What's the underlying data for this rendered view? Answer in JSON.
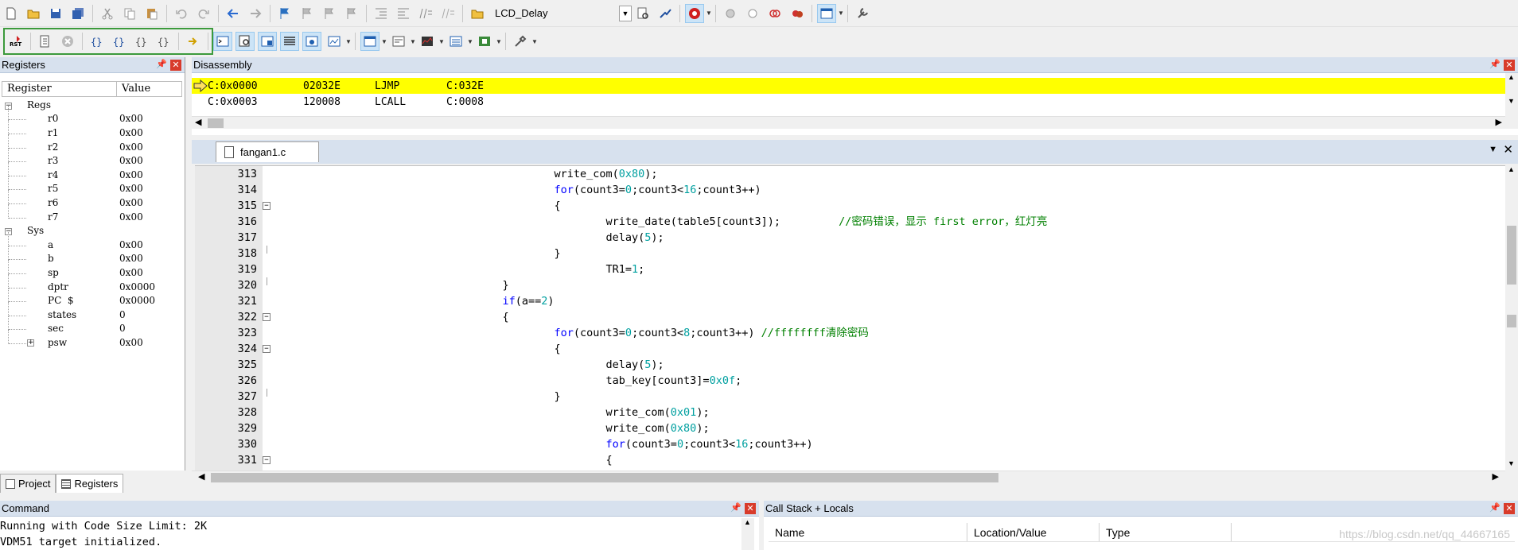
{
  "toolbar": {
    "target_combo": "LCD_Delay"
  },
  "registers": {
    "title": "Registers",
    "col_register": "Register",
    "col_value": "Value",
    "groups": [
      {
        "name": "Regs",
        "expanded": true,
        "items": [
          {
            "name": "r0",
            "value": "0x00"
          },
          {
            "name": "r1",
            "value": "0x00"
          },
          {
            "name": "r2",
            "value": "0x00"
          },
          {
            "name": "r3",
            "value": "0x00"
          },
          {
            "name": "r4",
            "value": "0x00"
          },
          {
            "name": "r5",
            "value": "0x00"
          },
          {
            "name": "r6",
            "value": "0x00"
          },
          {
            "name": "r7",
            "value": "0x00"
          }
        ]
      },
      {
        "name": "Sys",
        "expanded": true,
        "items": [
          {
            "name": "a",
            "value": "0x00"
          },
          {
            "name": "b",
            "value": "0x00"
          },
          {
            "name": "sp",
            "value": "0x00"
          },
          {
            "name": "dptr",
            "value": "0x0000"
          },
          {
            "name": "PC  $",
            "value": "0x0000"
          },
          {
            "name": "states",
            "value": "0"
          },
          {
            "name": "sec",
            "value": "0"
          },
          {
            "name": "psw",
            "value": "0x00",
            "collapsed": true
          }
        ]
      }
    ],
    "tab_project": "Project",
    "tab_registers": "Registers"
  },
  "disassembly": {
    "title": "Disassembly",
    "lines": [
      {
        "addr": "C:0x0000",
        "hex": "02032E",
        "mnemonic": "LJMP",
        "operand": "C:032E",
        "current": true
      },
      {
        "addr": "C:0x0003",
        "hex": "120008",
        "mnemonic": "LCALL",
        "operand": "C:0008",
        "current": false
      }
    ]
  },
  "editor": {
    "file_tab": "fangan1.c",
    "lines": [
      {
        "n": "313",
        "fold": "",
        "html": "                                           write_com(<span class='num'>0x80</span>);"
      },
      {
        "n": "314",
        "fold": "",
        "html": "                                           <span class='kw'>for</span>(count3=<span class='num'>0</span>;count3&lt;<span class='num'>16</span>;count3++)"
      },
      {
        "n": "315",
        "fold": "box",
        "html": "                                           {"
      },
      {
        "n": "316",
        "fold": "",
        "html": "                                                   write_date(table5[count3]);         <span class='cmt'>//密码错误，显示 first error，红灯亮</span>"
      },
      {
        "n": "317",
        "fold": "",
        "html": "                                                   delay(<span class='num'>5</span>);"
      },
      {
        "n": "318",
        "fold": "end",
        "html": "                                           }"
      },
      {
        "n": "319",
        "fold": "",
        "html": "                                                   TR1=<span class='num'>1</span>;"
      },
      {
        "n": "320",
        "fold": "end",
        "html": "                                   }"
      },
      {
        "n": "321",
        "fold": "",
        "html": "                                   <span class='kw'>if</span>(a==<span class='num'>2</span>)"
      },
      {
        "n": "322",
        "fold": "box",
        "html": "                                   {"
      },
      {
        "n": "323",
        "fold": "",
        "html": "                                           <span class='kw'>for</span>(count3=<span class='num'>0</span>;count3&lt;<span class='num'>8</span>;count3++) <span class='cmt'>//ffffffff清除密码</span>"
      },
      {
        "n": "324",
        "fold": "box",
        "html": "                                           {"
      },
      {
        "n": "325",
        "fold": "",
        "html": "                                                   delay(<span class='num'>5</span>);"
      },
      {
        "n": "326",
        "fold": "",
        "html": "                                                   tab_key[count3]=<span class='num'>0x0f</span>;"
      },
      {
        "n": "327",
        "fold": "end",
        "html": "                                           }"
      },
      {
        "n": "328",
        "fold": "",
        "html": "                                                   write_com(<span class='num'>0x01</span>);"
      },
      {
        "n": "329",
        "fold": "",
        "html": "                                                   write_com(<span class='num'>0x80</span>);"
      },
      {
        "n": "330",
        "fold": "",
        "html": "                                                   <span class='kw'>for</span>(count3=<span class='num'>0</span>;count3&lt;<span class='num'>16</span>;count3++)"
      },
      {
        "n": "331",
        "fold": "box",
        "html": "                                                   {"
      }
    ]
  },
  "command": {
    "title": "Command",
    "lines": [
      "Running with Code Size Limit: 2K",
      "VDM51 target initialized."
    ]
  },
  "callstack": {
    "title": "Call Stack + Locals",
    "columns": [
      "Name",
      "Location/Value",
      "Type"
    ],
    "watermark": "https://blog.csdn.net/qq_44667165"
  },
  "colors": {
    "current_line": "#ffff00",
    "panel_title": "#d7e1ee",
    "keyword": "#0000ff",
    "number": "#00a0a0",
    "comment": "#008000"
  }
}
